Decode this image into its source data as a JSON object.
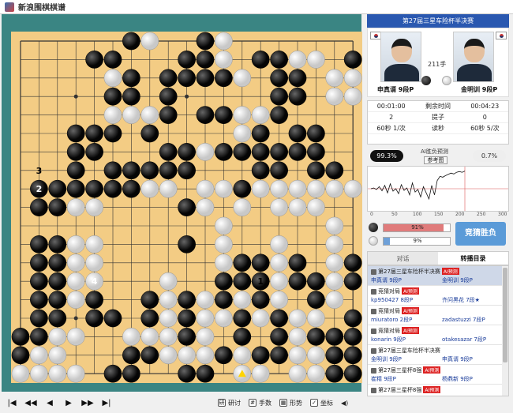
{
  "app": {
    "title": "新浪围棋棋谱"
  },
  "match": {
    "title": "第27届三星车险杯半决赛",
    "move_count": "211手"
  },
  "players": {
    "black": {
      "name": "申真谞 9段P",
      "used_time": "00:01:00",
      "captures": "2",
      "byoyomi": "60秒 1/次"
    },
    "white": {
      "name": "金明训 9段P",
      "used_time": "00:04:23",
      "captures": "0",
      "byoyomi": "60秒 5/次"
    }
  },
  "stats_labels": {
    "remaining": "剩余时间",
    "captures": "提子",
    "byoyomi": "读秒"
  },
  "ai": {
    "label": "AI胜负预测",
    "ref_button": "参考图",
    "black_pct": "99.3%",
    "white_pct": "0.7%"
  },
  "graph": {
    "x_ticks": [
      "0",
      "50",
      "100",
      "150",
      "200",
      "250",
      "300"
    ],
    "series": [
      50,
      52,
      48,
      55,
      45,
      58,
      40,
      62,
      44,
      50,
      38,
      60,
      46,
      52,
      35,
      64,
      42,
      48,
      30,
      55,
      40,
      25,
      58,
      35,
      70,
      80,
      78,
      82,
      85,
      88,
      86,
      90,
      92,
      90,
      93
    ]
  },
  "guess": {
    "black_pct": "91%",
    "white_pct": "9%",
    "black_value": 0.91,
    "white_value": 0.09,
    "button": "竞猜胜负"
  },
  "tabs": [
    {
      "label": "对话"
    },
    {
      "label": "转播目录"
    }
  ],
  "list": [
    {
      "title": "第27届三星车险杯半决赛",
      "badge": "AI预测",
      "p1": "申真谞 9段P",
      "p2": "金明训 9段P",
      "selected": true
    },
    {
      "title": "竞猜对局",
      "badge": "AI预测",
      "p1": "kp950427 8段P",
      "p2": "齐问黑花 7段★",
      "selected": false
    },
    {
      "title": "竞猜对局",
      "badge": "AI预测",
      "p1": "miuratoro 2段P",
      "p2": "zadastuzzi 7段P",
      "selected": false
    },
    {
      "title": "竞猜对局",
      "badge": "AI预测",
      "p1": "konarin 9段P",
      "p2": "otakesazar 7段P",
      "selected": false
    },
    {
      "title": "第27届三星车险杯半决赛",
      "badge": "",
      "p1": "金明训 9段P",
      "p2": "申真谞 9段P",
      "selected": false
    },
    {
      "title": "第27届三星杯8强",
      "badge": "AI预测",
      "p1": "崔精 9段P",
      "p2": "杨鼎新 9段P",
      "selected": false
    },
    {
      "title": "第27届三星杯8强",
      "badge": "AI预测",
      "p1": "",
      "p2": "",
      "selected": false
    }
  ],
  "toolbar": {
    "study": "研讨",
    "moves": "手数",
    "shape": "形势",
    "coords": "坐标"
  },
  "board": {
    "size": 19,
    "black": [
      "F1",
      "G1",
      "J1",
      "K1",
      "R1",
      "S1",
      "A2",
      "G2",
      "H2",
      "L2",
      "N2",
      "O2",
      "R2",
      "S2",
      "A3",
      "B3",
      "J3",
      "M3",
      "O3",
      "Q3",
      "R3",
      "S3",
      "B4",
      "C4",
      "E4",
      "F4",
      "H4",
      "J4",
      "M4",
      "O4",
      "S4",
      "B5",
      "C5",
      "E5",
      "H5",
      "J5",
      "L5",
      "N5",
      "Q5",
      "T5",
      "B6",
      "C6",
      "L6",
      "M6",
      "N6",
      "P6",
      "Q6",
      "S6",
      "B7",
      "C7",
      "M7",
      "N7",
      "P7",
      "S7",
      "B8",
      "C8",
      "J8",
      "B10",
      "C10",
      "J10",
      "B11",
      "C11",
      "D11",
      "E11",
      "F11",
      "G11",
      "M11",
      "D12",
      "F12",
      "G12",
      "H12",
      "I12",
      "J12",
      "N12",
      "O12",
      "Q12",
      "R12",
      "D13",
      "E13",
      "I13",
      "J13",
      "L13",
      "M13",
      "N13",
      "O13",
      "P13",
      "Q13",
      "D14",
      "E14",
      "F14",
      "H14",
      "N14",
      "P14",
      "Q14",
      "I15",
      "K15",
      "L15",
      "O15",
      "F16",
      "G16",
      "I16",
      "O16",
      "P16",
      "G17",
      "I17",
      "J17",
      "K17",
      "L17",
      "O17",
      "P17",
      "E18",
      "F18",
      "J18",
      "K18",
      "N18",
      "O18",
      "S18",
      "G19",
      "K19"
    ],
    "white": [
      "A1",
      "B1",
      "C1",
      "D1",
      "M1",
      "N1",
      "P1",
      "Q1",
      "B2",
      "C2",
      "I2",
      "J2",
      "K2",
      "M2",
      "P2",
      "Q2",
      "C3",
      "D3",
      "G3",
      "H3",
      "I3",
      "K3",
      "P3",
      "I4",
      "K4",
      "L4",
      "N4",
      "P4",
      "Q4",
      "D5",
      "I5",
      "K5",
      "M5",
      "O5",
      "R5",
      "D6",
      "E6",
      "I6",
      "O6",
      "R6",
      "D7",
      "E7",
      "L7",
      "O7",
      "R7",
      "D8",
      "E8",
      "L8",
      "O8",
      "R8",
      "L9",
      "R9",
      "C10",
      "D10",
      "E10",
      "K10",
      "M10",
      "O10",
      "P10",
      "Q10",
      "D11",
      "E11",
      "H11",
      "I11",
      "K11",
      "L11",
      "N11",
      "O11",
      "P11",
      "Q11",
      "R11",
      "S11",
      "I13",
      "K13",
      "L13",
      "M14",
      "N14",
      "F15",
      "G15",
      "H15",
      "M15",
      "N15",
      "O15",
      "R16",
      "S16",
      "F17",
      "G17",
      "M17",
      "O17",
      "R17",
      "S17",
      "J18",
      "L18",
      "P18",
      "Q18",
      "H19",
      "L19"
    ],
    "labels": [
      {
        "coord": "B12",
        "text": "3",
        "color": "white_stone"
      },
      {
        "coord": "B11",
        "text": "2",
        "color": "black_stone"
      },
      {
        "coord": "N6",
        "text": "1",
        "color": "white_stone"
      },
      {
        "coord": "E6",
        "text": "4",
        "color": "black_stone"
      }
    ],
    "last_move": "M1"
  }
}
